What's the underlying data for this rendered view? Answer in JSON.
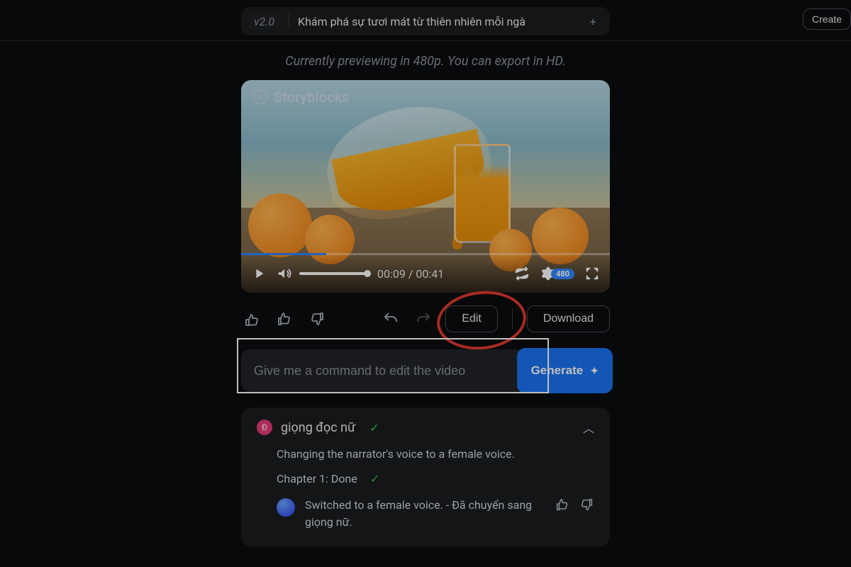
{
  "header": {
    "version": "v2.0",
    "title": "Khám phá sự tươi mát từ thiên nhiên mỗi ngà",
    "plus_tooltip": "+",
    "create_label": "Create"
  },
  "preview_note": "Currently previewing in 480p. You can export in HD.",
  "video": {
    "watermark": "Storyblocks",
    "current_time": "00:09",
    "total_time": "00:41",
    "time_sep": " / ",
    "quality_badge": "480",
    "progress_pct": 23
  },
  "actions": {
    "edit_label": "Edit",
    "download_label": "Download"
  },
  "command": {
    "placeholder": "Give me a command to edit the video",
    "generate_label": "Generate"
  },
  "history": {
    "avatar_initial": "Đ",
    "title": "giọng đọc nữ",
    "description": "Changing the narrator's voice to a female voice.",
    "chapter_prefix": "Chapter 1: ",
    "chapter_status": "Done",
    "bot_message": "Switched to a female voice. - Đã chuyển sang giọng nữ."
  }
}
